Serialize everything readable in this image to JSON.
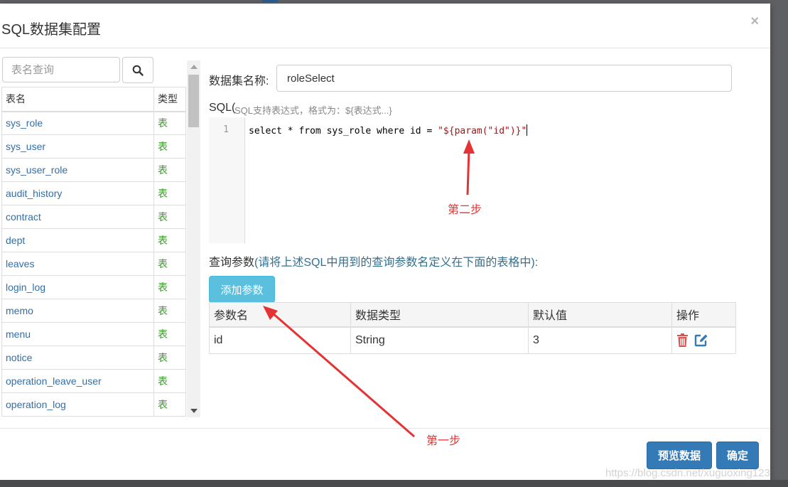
{
  "modal": {
    "title": "SQL数据集配置",
    "close_glyph": "×"
  },
  "table_browser": {
    "search_placeholder": "表名查询",
    "columns": {
      "name": "表名",
      "type": "类型"
    },
    "rows": [
      {
        "name": "sys_role",
        "type": "表"
      },
      {
        "name": "sys_user",
        "type": "表"
      },
      {
        "name": "sys_user_role",
        "type": "表"
      },
      {
        "name": "audit_history",
        "type": "表"
      },
      {
        "name": "contract",
        "type": "表"
      },
      {
        "name": "dept",
        "type": "表"
      },
      {
        "name": "leaves",
        "type": "表"
      },
      {
        "name": "login_log",
        "type": "表"
      },
      {
        "name": "memo",
        "type": "表"
      },
      {
        "name": "menu",
        "type": "表"
      },
      {
        "name": "notice",
        "type": "表"
      },
      {
        "name": "operation_leave_user",
        "type": "表"
      },
      {
        "name": "operation_log",
        "type": "表"
      }
    ]
  },
  "dataset": {
    "name_label": "数据集名称:",
    "name_value": "roleSelect"
  },
  "sql": {
    "label": "SQL(",
    "hint": "SQL支持表达式，格式为：${表达式...}",
    "line_number": "1",
    "code_prefix": "select * from sys_role where id = ",
    "code_string": "\"${param(\"id\")}\""
  },
  "annotations": {
    "step1": "第一步",
    "step2": "第二步"
  },
  "params": {
    "label": "查询参数",
    "hint": "(请将上述SQL中用到的查询参数名定义在下面的表格中):",
    "add_button": "添加参数",
    "columns": {
      "name": "参数名",
      "type": "数据类型",
      "default": "默认值",
      "ops": "操作"
    },
    "rows": [
      {
        "name": "id",
        "type": "String",
        "default": "3"
      }
    ]
  },
  "footer": {
    "preview_button": "预览数据",
    "confirm_button": "确定"
  },
  "watermark": "https://blog.csdn.net/xuguoxing123",
  "colors": {
    "primary": "#337ab7",
    "info": "#5bc0de",
    "annotation_red": "#e53333",
    "delete_red": "#d9534f"
  }
}
